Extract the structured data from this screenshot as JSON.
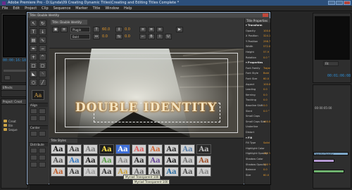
{
  "window": {
    "title": "Adobe Premiere Pro - D:\\Lynda\\09 Creating Dynamic Titles\\Creating and Editing Titles Complete *"
  },
  "menu": [
    "File",
    "Edit",
    "Project",
    "Clip",
    "Sequence",
    "Marker",
    "Title",
    "Window",
    "Help"
  ],
  "left_panels": {
    "source_timecode": "00:00:16:18",
    "effects_tab": "Effects",
    "project_tab": "Project: Creat",
    "folders": [
      "Creat",
      "Bin",
      "Seque"
    ]
  },
  "right_panels": {
    "program_timecode_a": "00:01:06:08",
    "fit_label": "Fit",
    "program_timecode_b": "00:01:06:08",
    "timeline_marks": [
      "00:00:05:00",
      "00:00:06:00"
    ],
    "clip_label": "Opacity:Opacity"
  },
  "dialog": {
    "title": "Title: Double Identity",
    "font_family": "Plugin",
    "font_style": "Bold",
    "size": "60.0",
    "kerning": "0.0",
    "leading": "0.0",
    "tracking": "0.0",
    "main_text": "DOUBLE IDENTITY"
  },
  "tool_groups": {
    "align": "Align",
    "center": "Center",
    "distribute": "Distribute"
  },
  "styles_panel": {
    "title": "Title Styles",
    "swatch_text": "Aa",
    "tooltips": [
      "Myriad Transparent 100",
      "Myriad Transparent 100"
    ]
  },
  "properties": {
    "title": "Title Properties",
    "sections": [
      {
        "kind": "section",
        "label": "Transform"
      },
      {
        "kind": "row",
        "label": "Opacity",
        "value": "100.0 %"
      },
      {
        "kind": "row",
        "label": "X Position",
        "value": "324.1"
      },
      {
        "kind": "row",
        "label": "Y Position",
        "value": "298.7"
      },
      {
        "kind": "row",
        "label": "Width",
        "value": "572.0"
      },
      {
        "kind": "row",
        "label": "Height",
        "value": "57.9"
      },
      {
        "kind": "row",
        "label": "Rotation",
        "value": "0.0 °"
      },
      {
        "kind": "section",
        "label": "Properties"
      },
      {
        "kind": "row",
        "label": "Font Family",
        "value": "Trajan Pro"
      },
      {
        "kind": "row",
        "label": "Font Style",
        "value": "Bold"
      },
      {
        "kind": "row",
        "label": "Font Size",
        "value": "60.0"
      },
      {
        "kind": "row",
        "label": "Aspect",
        "value": "100.0 %"
      },
      {
        "kind": "row",
        "label": "Leading",
        "value": "0.0"
      },
      {
        "kind": "row",
        "label": "Kerning",
        "value": "0.0"
      },
      {
        "kind": "row",
        "label": "Tracking",
        "value": "0.0"
      },
      {
        "kind": "row",
        "label": "Baseline Shift",
        "value": "0.0"
      },
      {
        "kind": "row",
        "label": "Slant",
        "value": "0.0 °"
      },
      {
        "kind": "row",
        "label": "Small Caps",
        "value": ""
      },
      {
        "kind": "row",
        "label": "Small Caps Size",
        "value": "100.0 %"
      },
      {
        "kind": "row",
        "label": "Underline",
        "value": ""
      },
      {
        "kind": "row",
        "label": "Distort",
        "value": ""
      },
      {
        "kind": "section",
        "label": "Fill"
      },
      {
        "kind": "row",
        "label": "Fill Type",
        "value": "Solid"
      },
      {
        "kind": "row",
        "label": "Highlight Color",
        "value": ""
      },
      {
        "kind": "row",
        "label": "Highlight Opacity",
        "value": "100 %"
      },
      {
        "kind": "row",
        "label": "Shadow Color",
        "value": ""
      },
      {
        "kind": "row",
        "label": "Shadow Opacity",
        "value": "100 %"
      },
      {
        "kind": "row",
        "label": "Balance",
        "value": "0.0"
      },
      {
        "kind": "row",
        "label": "Size",
        "value": "60.0"
      }
    ]
  }
}
